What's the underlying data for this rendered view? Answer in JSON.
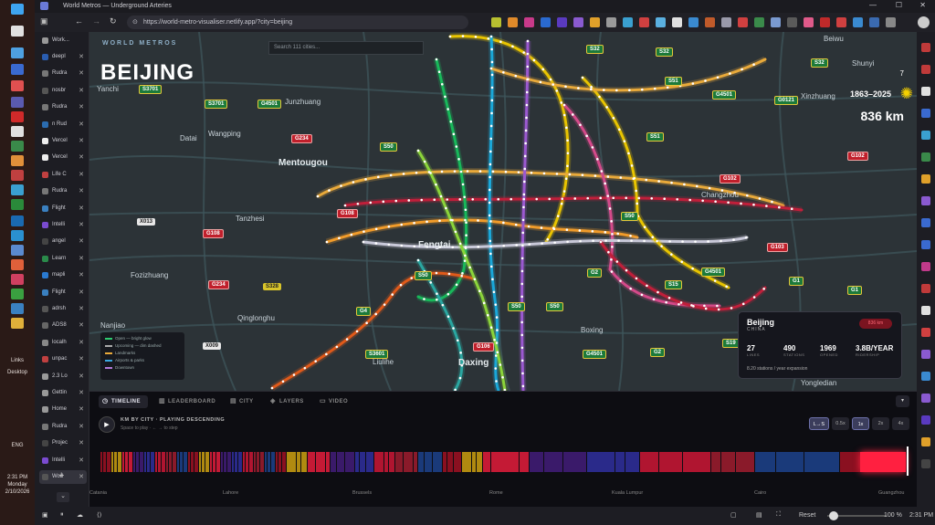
{
  "window": {
    "title": "World Metros — Underground Arteries"
  },
  "browser": {
    "url": "https://world-metro-visualiser.netlify.app/?city=beijing",
    "workspace_label": "Work...",
    "tabs": [
      {
        "label": "deepl",
        "color": "#2a5db0"
      },
      {
        "label": "Rudra",
        "color": "#777777"
      },
      {
        "label": "nosbr",
        "color": "#555555"
      },
      {
        "label": "Rudra",
        "color": "#777777"
      },
      {
        "label": "n Rud",
        "color": "#2b6cb0"
      },
      {
        "label": "Vercel",
        "color": "#eeeeee"
      },
      {
        "label": "Vercel",
        "color": "#eeeeee"
      },
      {
        "label": "Life C",
        "color": "#c04040"
      },
      {
        "label": "Rudra",
        "color": "#777777"
      },
      {
        "label": "Flight",
        "color": "#3a80c0"
      },
      {
        "label": "Intelli",
        "color": "#7a4bd0"
      },
      {
        "label": "angel",
        "color": "#444444"
      },
      {
        "label": "Learn",
        "color": "#2a8a4a"
      },
      {
        "label": "mapli",
        "color": "#2a7ad0"
      },
      {
        "label": "Flight",
        "color": "#3a80c0"
      },
      {
        "label": "adrsh",
        "color": "#555555"
      },
      {
        "label": "ADS8",
        "color": "#666666"
      },
      {
        "label": "localh",
        "color": "#888888"
      },
      {
        "label": "unpac",
        "color": "#c04040"
      },
      {
        "label": "2.3 Lo",
        "color": "#999999"
      },
      {
        "label": "Gettin",
        "color": "#999999"
      },
      {
        "label": "Home",
        "color": "#999999"
      },
      {
        "label": "Rudra",
        "color": "#777777"
      },
      {
        "label": "Projec",
        "color": "#444444"
      },
      {
        "label": "Intelli",
        "color": "#7a4bd0"
      },
      {
        "label": "Worl",
        "color": "#555555"
      }
    ],
    "zoom": "100 %",
    "reset_label": "Reset",
    "clock": "2:31 PM"
  },
  "taskbar": {
    "links_label": "Links",
    "desktop_label": "Desktop",
    "lang": "ENG",
    "time": "2:31 PM",
    "day": "Monday",
    "date": "2/10/2026"
  },
  "map": {
    "brand": "WORLD METROS",
    "city_title": "BEIJING",
    "search_placeholder": "Search 111 cities...",
    "top_number": "7",
    "year_range": "1863–2025",
    "length": "836 km",
    "places": [
      {
        "name": "Mentougou"
      },
      {
        "name": "Fengtai"
      },
      {
        "name": "Daxing"
      },
      {
        "name": "Junzhuang"
      },
      {
        "name": "Datai"
      },
      {
        "name": "Wangping"
      },
      {
        "name": "Tanzhesi"
      },
      {
        "name": "Fozizhuang"
      },
      {
        "name": "Qinglonghu"
      },
      {
        "name": "Nanjiao"
      },
      {
        "name": "Yanchi"
      },
      {
        "name": "Changzhou"
      },
      {
        "name": "Yongledian"
      },
      {
        "name": "Boxing"
      },
      {
        "name": "Liulihe"
      },
      {
        "name": "Beiwu"
      },
      {
        "name": "Xinzhuang"
      },
      {
        "name": "Shunyi"
      }
    ],
    "shields": [
      {
        "text": "S3701",
        "kind": "green"
      },
      {
        "text": "S3701",
        "kind": "green"
      },
      {
        "text": "G4501",
        "kind": "green"
      },
      {
        "text": "G234",
        "kind": "red"
      },
      {
        "text": "S50",
        "kind": "green"
      },
      {
        "text": "X013",
        "kind": "white"
      },
      {
        "text": "G108",
        "kind": "red"
      },
      {
        "text": "G108",
        "kind": "red"
      },
      {
        "text": "G234",
        "kind": "red"
      },
      {
        "text": "S328",
        "kind": "yellow"
      },
      {
        "text": "S50",
        "kind": "green"
      },
      {
        "text": "G4",
        "kind": "green"
      },
      {
        "text": "X009",
        "kind": "white"
      },
      {
        "text": "S3601",
        "kind": "green"
      },
      {
        "text": "S32",
        "kind": "green"
      },
      {
        "text": "S32",
        "kind": "green"
      },
      {
        "text": "S51",
        "kind": "green"
      },
      {
        "text": "G4501",
        "kind": "green"
      },
      {
        "text": "G0121",
        "kind": "green"
      },
      {
        "text": "S51",
        "kind": "green"
      },
      {
        "text": "G102",
        "kind": "red"
      },
      {
        "text": "G102",
        "kind": "red"
      },
      {
        "text": "G103",
        "kind": "red"
      },
      {
        "text": "S50",
        "kind": "green"
      },
      {
        "text": "G4501",
        "kind": "green"
      },
      {
        "text": "G1",
        "kind": "green"
      },
      {
        "text": "G1",
        "kind": "green"
      },
      {
        "text": "S15",
        "kind": "green"
      },
      {
        "text": "G2",
        "kind": "green"
      },
      {
        "text": "G2",
        "kind": "green"
      },
      {
        "text": "G4501",
        "kind": "green"
      },
      {
        "text": "S19",
        "kind": "green"
      },
      {
        "text": "G106",
        "kind": "red"
      },
      {
        "text": "S32",
        "kind": "green"
      },
      {
        "text": "S50",
        "kind": "green"
      },
      {
        "text": "S50",
        "kind": "green"
      }
    ],
    "metro_lines": [
      {
        "color": "#e8c400"
      },
      {
        "color": "#e8a93a"
      },
      {
        "color": "#c01f3a"
      },
      {
        "color": "#f09b2a"
      },
      {
        "color": "#1aa7d8"
      },
      {
        "color": "#9b59d0"
      },
      {
        "color": "#18b85a"
      },
      {
        "color": "#d44a8a"
      },
      {
        "color": "#c8c8d8"
      },
      {
        "color": "#2aa6a0"
      },
      {
        "color": "#e05a1a"
      },
      {
        "color": "#8bd43a"
      }
    ],
    "legend": [
      {
        "label": "Open — bright glow",
        "color": "#2ecc71"
      },
      {
        "label": "Upcoming — dim dashed",
        "color": "#aaaaaa"
      },
      {
        "label": "Landmarks",
        "color": "#e8a93a"
      },
      {
        "label": "Airports & parks",
        "color": "#3aa8e0"
      },
      {
        "label": "Downtown",
        "color": "#b07ad8"
      }
    ]
  },
  "info_card": {
    "city": "Beijing",
    "country": "CHINA",
    "badge": "836 km",
    "stats": [
      {
        "value": "27",
        "label": "LINES"
      },
      {
        "value": "490",
        "label": "STATIONS"
      },
      {
        "value": "1969",
        "label": "OPENED"
      },
      {
        "value": "3.8B/YEAR",
        "label": "RIDERSHIP"
      }
    ],
    "footer": "8.20 stations / year expansion"
  },
  "panel": {
    "tabs": [
      {
        "label": "TIMELINE",
        "icon": "clock-icon",
        "active": true
      },
      {
        "label": "LEADERBOARD",
        "icon": "bars-icon",
        "active": false
      },
      {
        "label": "CITY",
        "icon": "building-icon",
        "active": false
      },
      {
        "label": "LAYERS",
        "icon": "layers-icon",
        "active": false
      },
      {
        "label": "VIDEO",
        "icon": "video-icon",
        "active": false
      }
    ],
    "sort_title": "KM BY CITY · PLAYING DESCENDING",
    "sort_hint": "Space to play · ← → to step",
    "speeds": [
      {
        "label": "L→S",
        "on": true
      },
      {
        "label": "0.5x",
        "on": false
      },
      {
        "label": "1x",
        "on": true
      },
      {
        "label": "2x",
        "on": false
      },
      {
        "label": "4x",
        "on": false
      }
    ],
    "timeline_palette": [
      "#8a1020",
      "#b01530",
      "#c41a35",
      "#1a3a7a",
      "#2a2a8a",
      "#b08a10",
      "#8a1a2a",
      "#3a1a6a"
    ],
    "axis_labels": [
      "Catania",
      "Lahore",
      "Brussels",
      "Rome",
      "Kuala Lumpur",
      "Cairo",
      "Guangzhou"
    ],
    "highlight_color": "#ff2040",
    "current_city": "Beijing"
  }
}
